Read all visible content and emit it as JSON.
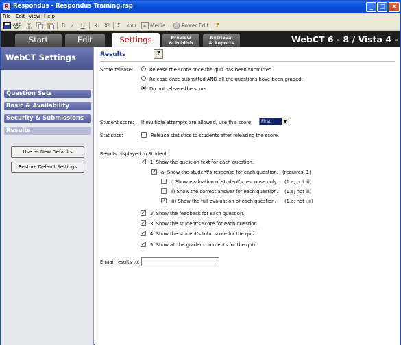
{
  "window": {
    "title": "Respondus - Respondus Training.rsp",
    "app_icon": "R"
  },
  "window_controls": {
    "minimize": "_",
    "maximize": "□",
    "close": "×"
  },
  "menu": {
    "file": "File",
    "edit": "Edit",
    "view": "View",
    "help": "Help"
  },
  "toolbar": {
    "bold": "B",
    "italic": "/",
    "underline": "U",
    "subscript": "X₂",
    "superscript": "X²",
    "symbol": "Σ",
    "link": "ωω",
    "media": "Media",
    "power_edit": "Power Edit",
    "help_icon": "?"
  },
  "nav": {
    "start": "Start",
    "edit": "Edit",
    "settings": "Settings",
    "preview_1": "Preview",
    "preview_2": "& Publish",
    "retrieval_1": "Retrieval",
    "retrieval_2": "& Reports",
    "version": "WebCT 6 - 8 / Vista 4 - 8"
  },
  "sidebar": {
    "title": "WebCT Settings",
    "items": [
      "Question Sets",
      "Basic & Availability",
      "Security & Submissions",
      "Results"
    ],
    "active_item": "Results",
    "use_defaults": "Use as New Defaults",
    "restore_defaults": "Restore Default Settings"
  },
  "content": {
    "title": "Results",
    "help": "?",
    "score_release_label": "Score release:",
    "score_release_options": [
      "Release the score once the quiz has been submitted.",
      "Release once submitted AND all the questions have been graded.",
      "Do not release the score."
    ],
    "score_release_selected": 2,
    "student_score_label": "Student score:",
    "student_score_text": "If multiple attempts are allowed, use this score:",
    "student_score_value": "First",
    "statistics_label": "Statistics:",
    "statistics_text": "Release statistics to students after releasing the score.",
    "statistics_checked": false,
    "results_label": "Results displayed to Student:",
    "results": [
      {
        "text": "1. Show the question text for each question.",
        "checked": true,
        "note": ""
      },
      {
        "text": "a) Show the student's response for each question.",
        "checked": true,
        "note": "(requires: 1)"
      },
      {
        "text": "i) Show evaluation of student's response only.",
        "checked": false,
        "note": "(1.a; not iii)"
      },
      {
        "text": "ii) Show the correct answer for each question.",
        "checked": false,
        "note": "(1.a; not iii)"
      },
      {
        "text": "iii) Show the full evaluation of each question.",
        "checked": true,
        "note": "(1.a; not i,ii)"
      },
      {
        "text": "2. Show the feedback for each question.",
        "checked": true,
        "note": ""
      },
      {
        "text": "3. Show the student's score for each question.",
        "checked": true,
        "note": ""
      },
      {
        "text": "4. Show the student's total score for the quiz.",
        "checked": true,
        "note": ""
      },
      {
        "text": "5. Show all the grader comments for the quiz.",
        "checked": true,
        "note": ""
      }
    ],
    "email_label": "E-mail results to:",
    "email_value": ""
  }
}
